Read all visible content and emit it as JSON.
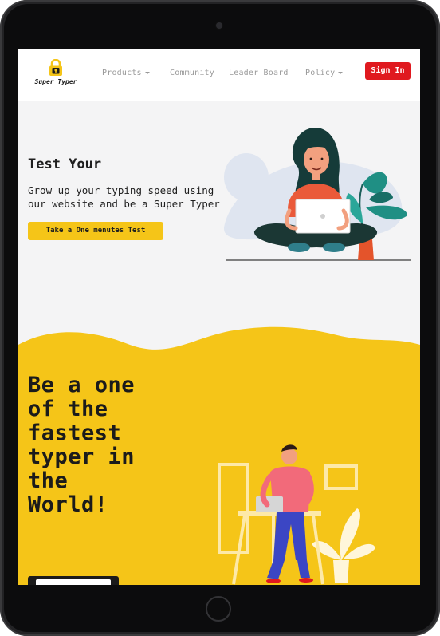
{
  "brand": {
    "name": "Super Typer"
  },
  "nav": {
    "items": [
      {
        "label": "Products",
        "dropdown": true
      },
      {
        "label": "Community",
        "dropdown": false
      },
      {
        "label": "Leader Board",
        "dropdown": false
      },
      {
        "label": "Policy",
        "dropdown": true
      }
    ],
    "signin_label": "Sign In"
  },
  "hero": {
    "title": "Test Your",
    "subtitle": "Grow up your typing speed using our website and be a Super Typer",
    "cta_label": "Take a One menutes Test"
  },
  "promo": {
    "heading_lines": [
      "Be a one",
      "of the",
      "fastest",
      "typer in",
      "the",
      "World!"
    ]
  },
  "colors": {
    "accent_yellow": "#f5c518",
    "signin_red": "#e0191f",
    "hero_bg": "#f4f4f5",
    "text_dark": "#1e1e1e"
  },
  "icons": [
    "padlock-logo-icon",
    "chevron-down-icon"
  ]
}
